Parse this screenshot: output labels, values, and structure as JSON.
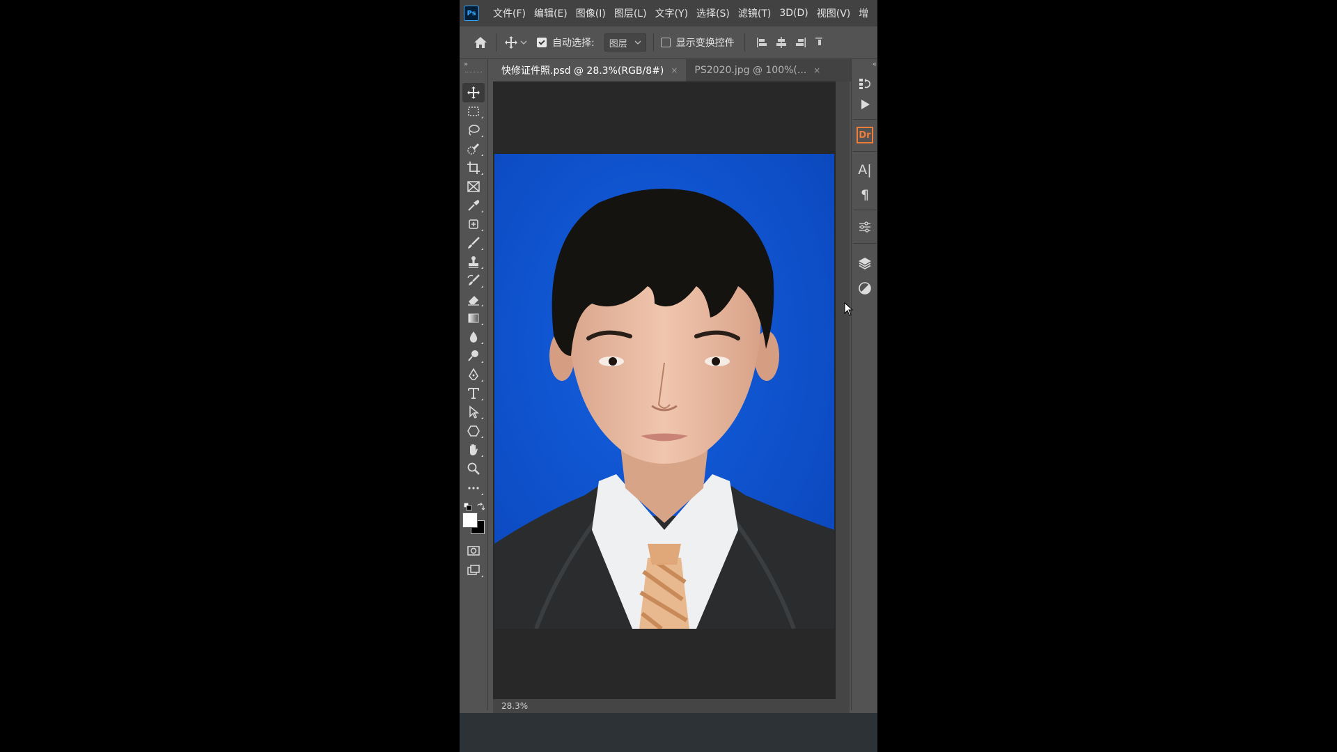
{
  "app": {
    "logo_text": "Ps",
    "accent_color": "#31a8ff"
  },
  "menubar": {
    "items": [
      "文件(F)",
      "编辑(E)",
      "图像(I)",
      "图层(L)",
      "文字(Y)",
      "选择(S)",
      "滤镜(T)",
      "3D(D)",
      "视图(V)",
      "增"
    ]
  },
  "options": {
    "auto_select_label": "自动选择:",
    "auto_select_checked": true,
    "auto_select_target": "图层",
    "show_transform_label": "显示变换控件",
    "show_transform_checked": false
  },
  "tools": [
    "move-tool",
    "marquee-tool",
    "lasso-tool",
    "quick-selection-tool",
    "crop-tool",
    "frame-tool",
    "eyedropper-tool",
    "spot-healing-tool",
    "brush-tool",
    "clone-stamp-tool",
    "history-brush-tool",
    "eraser-tool",
    "gradient-tool",
    "blur-tool",
    "dodge-tool",
    "pen-tool",
    "type-tool",
    "path-selection-tool",
    "shape-tool",
    "hand-tool",
    "zoom-tool",
    "more-tools"
  ],
  "colors": {
    "foreground": "#ffffff",
    "background": "#000000",
    "photo_background": "#0a4fd0"
  },
  "tabs": [
    {
      "label": "快修证件照.psd @ 28.3%(RGB/8#)",
      "close": "×",
      "active": true
    },
    {
      "label": "PS2020.jpg @ 100%(...",
      "close": "×",
      "active": false
    }
  ],
  "status": {
    "zoom": "28.3%"
  },
  "rightdock": {
    "dr_label": "Dr",
    "type_label": "A|",
    "paragraph_label": "¶"
  }
}
